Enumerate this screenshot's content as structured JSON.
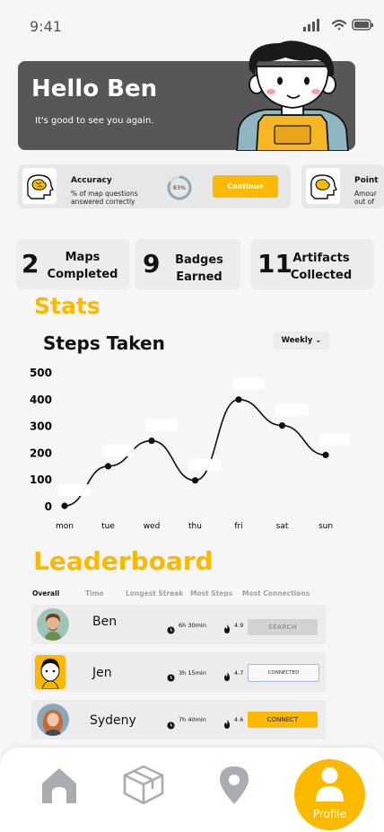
{
  "status": {
    "time": "9:41"
  },
  "hero": {
    "title": "Hello Ben",
    "subtitle": "It's good to see you again."
  },
  "accuracy": {
    "title": "Accuracy",
    "description": "% of map questions answered correctly",
    "percent": 83,
    "percent_label": "83%",
    "button": "Continue"
  },
  "points": {
    "title": "Point",
    "description_line1": "Amour",
    "description_line2": "out of"
  },
  "stats_boxes": [
    {
      "number": "2",
      "label_line1": "Maps",
      "label_line2": "Completed"
    },
    {
      "number": "9",
      "label_line1": "Badges",
      "label_line2": "Earned"
    },
    {
      "number": "11",
      "label_line1": "Artifacts",
      "label_line2": "Collected"
    }
  ],
  "stats_heading": "Stats",
  "chart_data": {
    "type": "line",
    "title": "Steps Taken",
    "period_selector": "Weekly",
    "categories": [
      "mon",
      "tue",
      "wed",
      "thu",
      "fri",
      "sat",
      "sun"
    ],
    "values": [
      0,
      148,
      243,
      95,
      397,
      300,
      190
    ],
    "yticks": [
      0,
      100,
      200,
      300,
      400,
      500
    ],
    "ylim": [
      0,
      500
    ],
    "xlabel": "",
    "ylabel": ""
  },
  "leaderboard": {
    "heading": "Leaderboard",
    "tabs": [
      "Overall",
      "Time",
      "Longest Streak",
      "Most Steps",
      "Most Connections"
    ],
    "rows": [
      {
        "name": "Ben",
        "time": "6h 30min",
        "streak": "4.9",
        "button": "SEARCH"
      },
      {
        "name": "Jen",
        "time": "3h 15min",
        "streak": "4.7",
        "button": "CONNECTED"
      },
      {
        "name": "Sydeny",
        "time": "7h 40min",
        "streak": "4.6",
        "button": "CONNECT"
      }
    ]
  },
  "nav": {
    "profile_label": "Profile"
  },
  "colors": {
    "accent": "#fbb900",
    "hero_bg": "#575757",
    "nav_icon": "#a9adb1"
  }
}
